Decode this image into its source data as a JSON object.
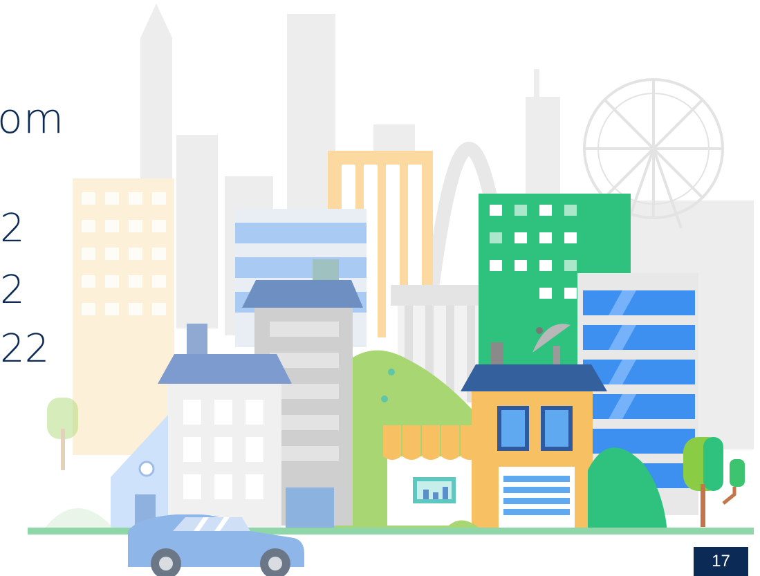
{
  "slide": {
    "heading_fragment": "om",
    "lines": [
      "2",
      "2",
      "22"
    ],
    "page_number": "17"
  },
  "colors": {
    "text": "#0b2a55",
    "page_box": "#0b2a55",
    "building_green": "#2ec27e",
    "building_blue": "#3d8ff0",
    "building_orange": "#f6c063",
    "roof_blue": "#4a6fa5",
    "car": "#8fb6e8"
  }
}
